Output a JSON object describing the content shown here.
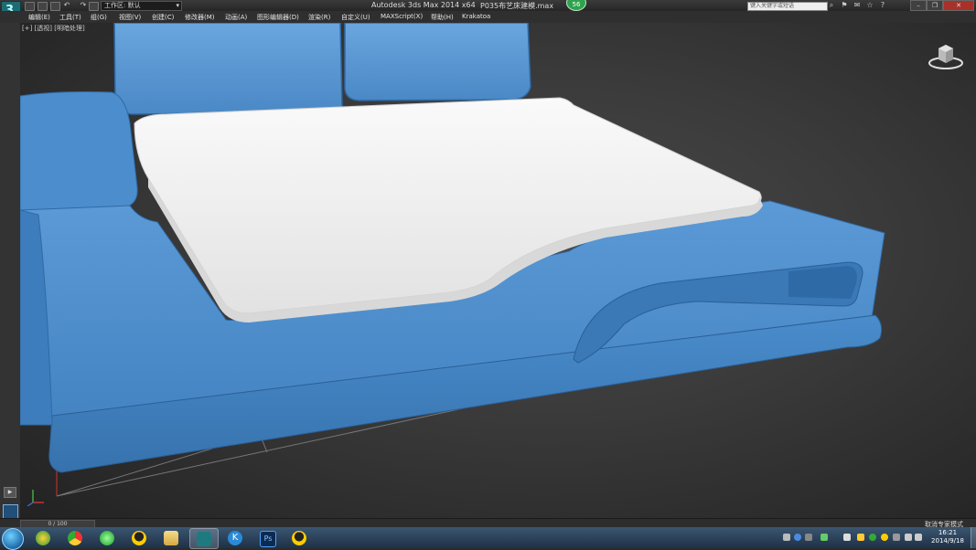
{
  "titlebar": {
    "workspace_label": "工作区: 默认",
    "app_title": "Autodesk 3ds Max  2014 x64",
    "file_title": "P035布艺床建模.max",
    "badge_count": "56",
    "search_placeholder": "键入关键字或短语"
  },
  "menu": {
    "items": [
      "编辑(E)",
      "工具(T)",
      "组(G)",
      "视图(V)",
      "创建(C)",
      "修改器(M)",
      "动画(A)",
      "图形编辑器(D)",
      "渲染(R)",
      "自定义(U)",
      "MAXScript(X)",
      "帮助(H)",
      "Krakatoa"
    ]
  },
  "viewport": {
    "label": "[+] [透视] [明暗处理]"
  },
  "statusbar": {
    "time_slider": "0 / 100",
    "status_text": "取消专家模式"
  },
  "taskbar": {
    "apps": [
      "start-orb",
      "360-browser",
      "chrome",
      "360-security",
      "qq",
      "file-explorer",
      "3ds-max",
      "krakatoa",
      "photoshop",
      "qq-chat"
    ],
    "clock_time": "16:21",
    "clock_date": "2014/9/18"
  },
  "colors": {
    "model_blue": "#4a8ccc",
    "mattress_white": "#f2f2f2",
    "viewport_bg": "#3a3a3a",
    "taskbar": "#2a4560"
  }
}
